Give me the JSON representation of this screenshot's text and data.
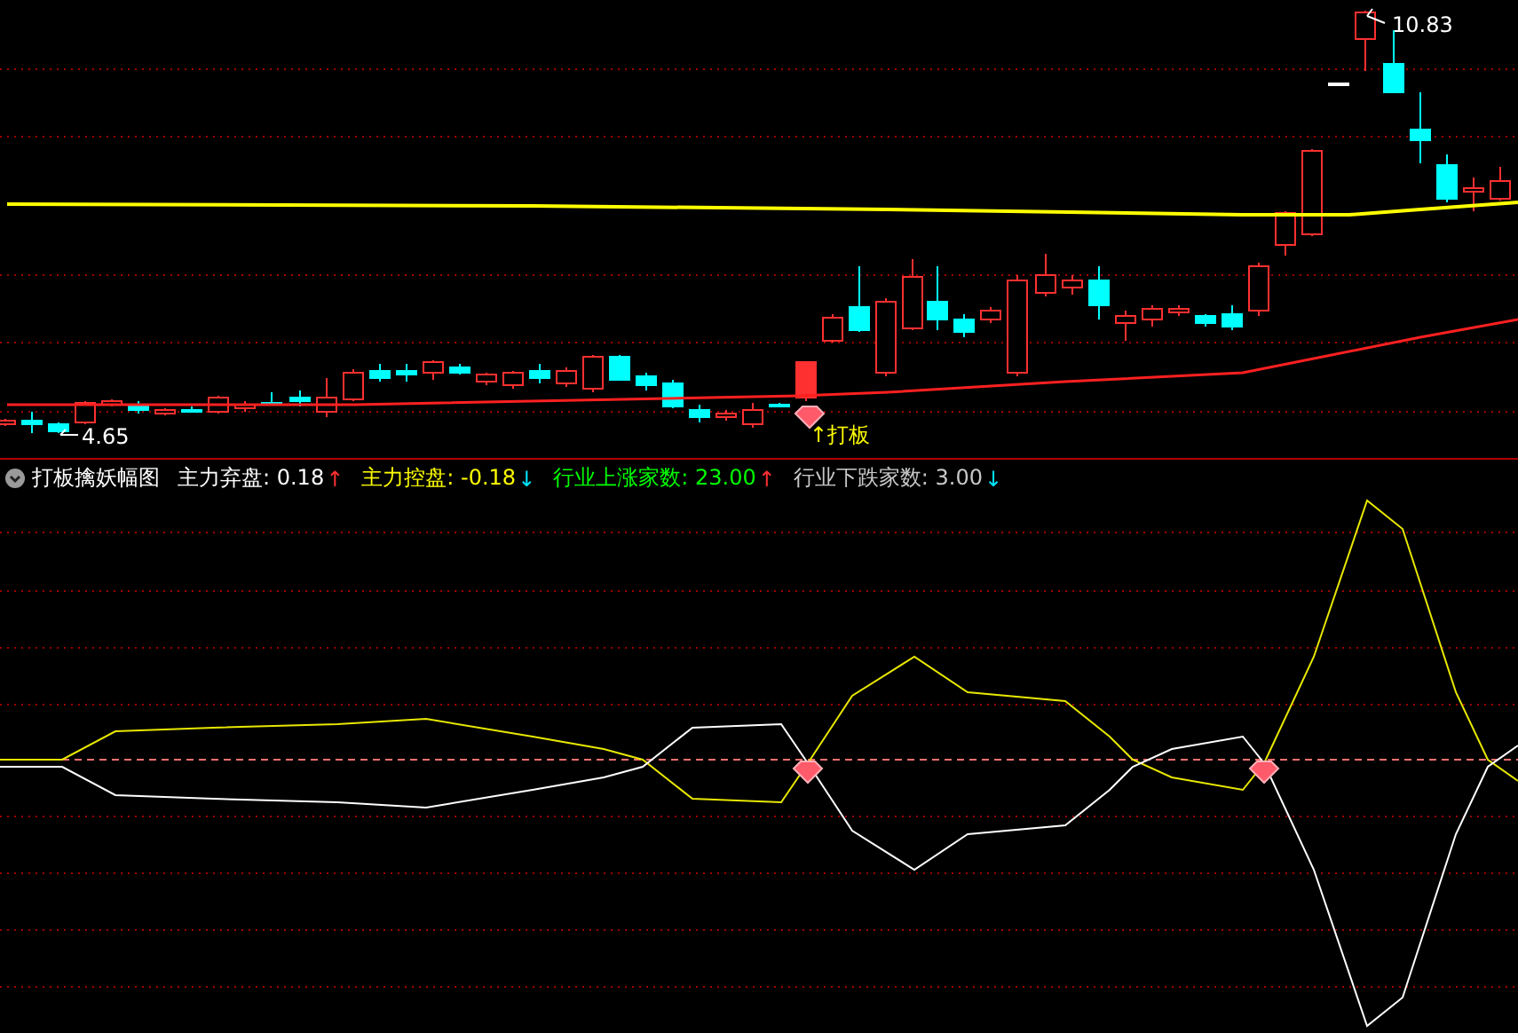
{
  "price_chart": {
    "high_label": "10.83",
    "low_label": "4.65",
    "signal_label": "↑打板"
  },
  "indicator": {
    "title": "打板擒妖幅图",
    "readings": [
      {
        "label": "主力弃盘:",
        "value": "0.18",
        "arrow": "↑",
        "kind": "rise",
        "color": "#ffffff"
      },
      {
        "label": "主力控盘:",
        "value": "-0.18",
        "arrow": "↓",
        "kind": "fall",
        "color": "#ffff00"
      },
      {
        "label": "行业上涨家数:",
        "value": "23.00",
        "arrow": "↑",
        "kind": "rise",
        "color": "#00ff00"
      },
      {
        "label": "行业下跌家数:",
        "value": "3.00",
        "arrow": "↓",
        "kind": "fall",
        "color": "#c8c8c8"
      }
    ]
  }
}
